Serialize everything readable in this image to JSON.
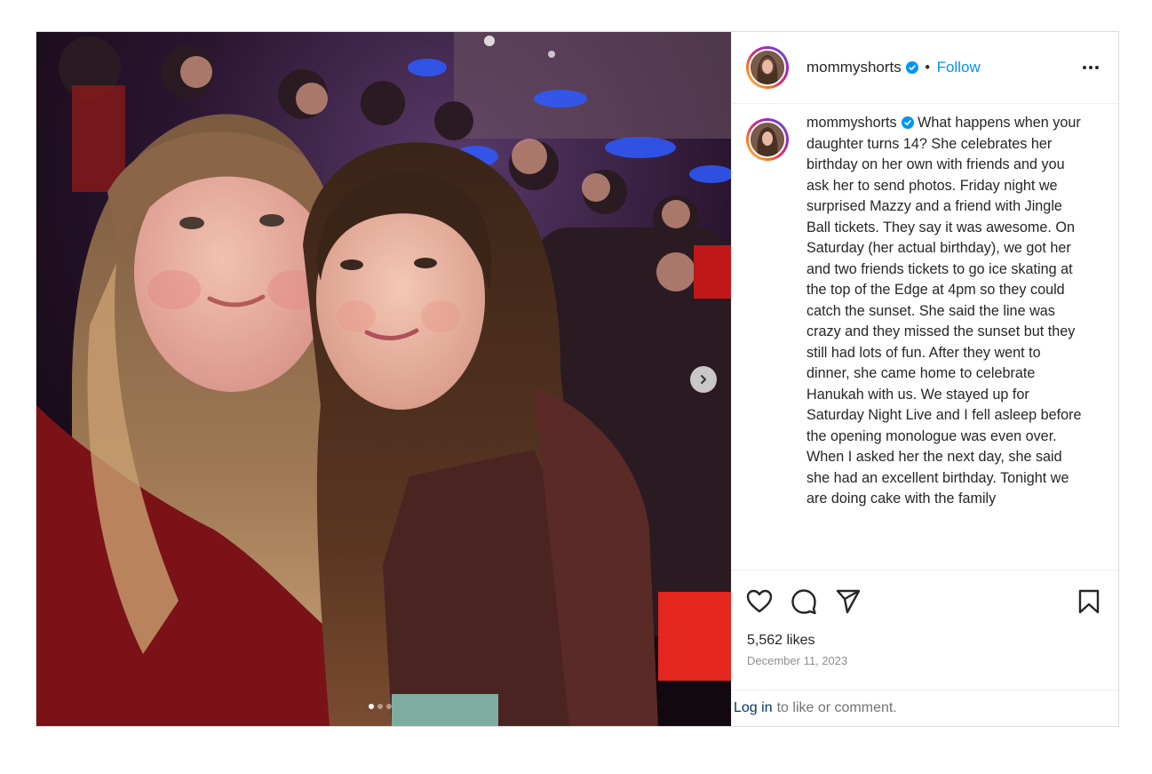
{
  "post": {
    "username": "mommyshorts",
    "separator": "•",
    "follow_label": "Follow",
    "caption_username": "mommyshorts",
    "caption": "What happens when your daughter turns 14? She celebrates her birthday on her own with friends and you ask her to send photos. Friday night we surprised Mazzy and a friend with Jingle Ball tickets. They say it was awesome. On Saturday (her actual birthday), we got her and two friends tickets to go ice skating at the top of the Edge at 4pm so they could catch the sunset. She said the line was crazy and they missed the sunset but they still had lots of fun. After they went to dinner, she came home to celebrate Hanukah with us. We stayed up for Saturday Night Live and I fell asleep before the opening monologue was even over. When I asked her the next day, she said she had an excellent birthday. Tonight we are doing cake with the family",
    "likes": "5,562 likes",
    "date": "December 11, 2023",
    "login_link": "Log in",
    "login_rest": "to like or comment."
  },
  "carousel": {
    "slide_count": 3,
    "active_index": 0
  },
  "icons": {
    "verified": "verified-badge-icon",
    "more": "more-options-icon",
    "like": "heart-icon",
    "comment": "comment-icon",
    "share": "paper-plane-icon",
    "save": "bookmark-icon",
    "next": "chevron-right-icon"
  },
  "colors": {
    "link_blue": "#0095f6",
    "verified_blue": "#0095f6",
    "text": "#262626",
    "muted": "#8e8e8e",
    "login_link": "#00376b"
  }
}
